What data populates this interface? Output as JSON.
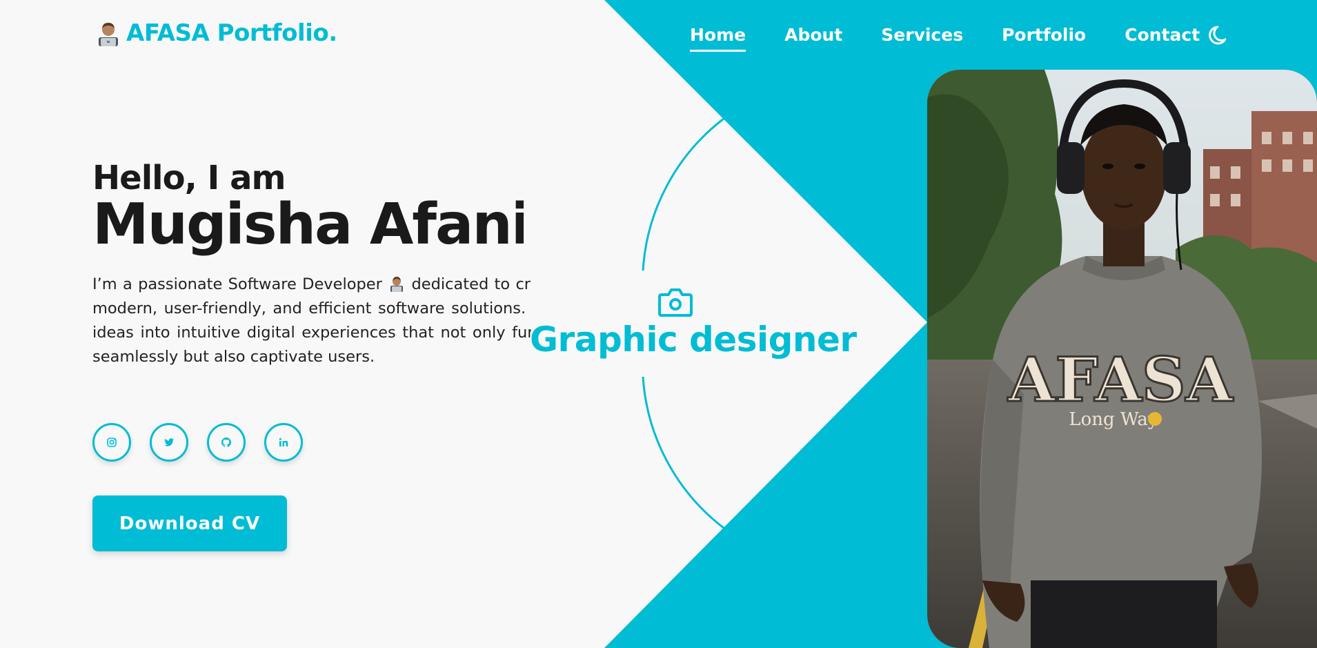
{
  "brand": {
    "logo_text": "AFASA Portfolio.",
    "emoji_icon": "man-technologist-emoji",
    "accent_color": "#00bcd4",
    "background_color": "#f8f8f8"
  },
  "nav": {
    "items": [
      {
        "label": "Home",
        "active": true
      },
      {
        "label": "About",
        "active": false
      },
      {
        "label": "Services",
        "active": false
      },
      {
        "label": "Portfolio",
        "active": false
      },
      {
        "label": "Contact",
        "active": false
      }
    ],
    "theme_toggle_icon": "moon-icon"
  },
  "hero": {
    "greeting": "Hello, I am",
    "name": "Mugisha Afani",
    "bio_before_emoji": "I’m a passionate Software Developer",
    "bio_after_emoji": "dedicated to crafting modern, user-friendly, and efficient software solutions. I turn ideas into intuitive digital experiences that not only function seamlessly but also captivate users."
  },
  "socials": [
    {
      "name": "instagram",
      "icon": "instagram-icon"
    },
    {
      "name": "twitter",
      "icon": "twitter-icon"
    },
    {
      "name": "github",
      "icon": "github-icon"
    },
    {
      "name": "linkedin",
      "icon": "linkedin-icon"
    }
  ],
  "cta": {
    "download_label": "Download CV"
  },
  "role": {
    "icon": "camera-icon",
    "label": "Graphic designer"
  },
  "photo": {
    "shirt_title": "AFASA",
    "shirt_subtitle": "Long Way"
  }
}
